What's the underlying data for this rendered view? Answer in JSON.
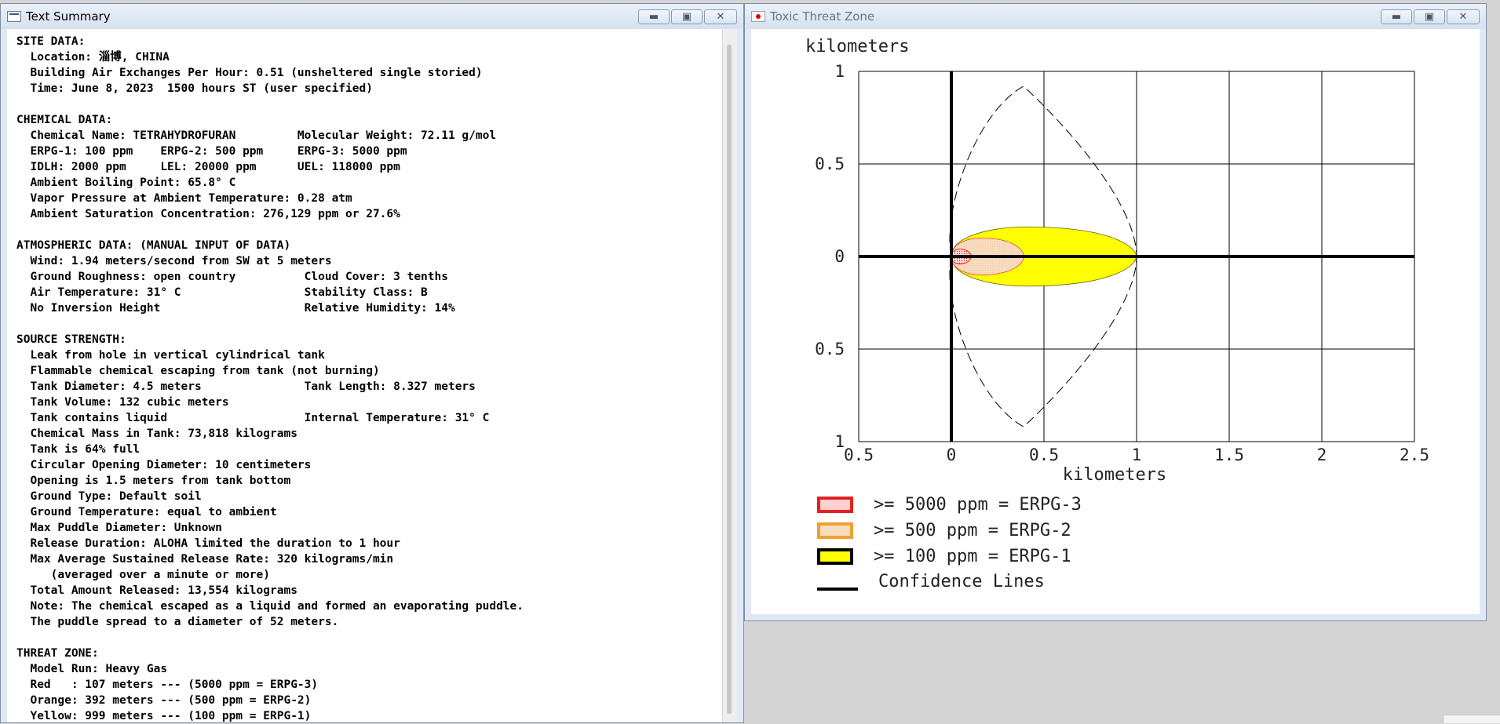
{
  "text_summary": {
    "title": "Text Summary",
    "content": "SITE DATA:\n  Location: 淄博, CHINA\n  Building Air Exchanges Per Hour: 0.51 (unsheltered single storied)\n  Time: June 8, 2023  1500 hours ST (user specified)\n\nCHEMICAL DATA:\n  Chemical Name: TETRAHYDROFURAN         Molecular Weight: 72.11 g/mol\n  ERPG-1: 100 ppm    ERPG-2: 500 ppm     ERPG-3: 5000 ppm\n  IDLH: 2000 ppm     LEL: 20000 ppm      UEL: 118000 ppm\n  Ambient Boiling Point: 65.8° C\n  Vapor Pressure at Ambient Temperature: 0.28 atm\n  Ambient Saturation Concentration: 276,129 ppm or 27.6%\n\nATMOSPHERIC DATA: (MANUAL INPUT OF DATA)\n  Wind: 1.94 meters/second from SW at 5 meters\n  Ground Roughness: open country          Cloud Cover: 3 tenths\n  Air Temperature: 31° C                  Stability Class: B\n  No Inversion Height                     Relative Humidity: 14%\n\nSOURCE STRENGTH:\n  Leak from hole in vertical cylindrical tank\n  Flammable chemical escaping from tank (not burning)\n  Tank Diameter: 4.5 meters               Tank Length: 8.327 meters\n  Tank Volume: 132 cubic meters\n  Tank contains liquid                    Internal Temperature: 31° C\n  Chemical Mass in Tank: 73,818 kilograms\n  Tank is 64% full\n  Circular Opening Diameter: 10 centimeters\n  Opening is 1.5 meters from tank bottom\n  Ground Type: Default soil\n  Ground Temperature: equal to ambient\n  Max Puddle Diameter: Unknown\n  Release Duration: ALOHA limited the duration to 1 hour\n  Max Average Sustained Release Rate: 320 kilograms/min\n     (averaged over a minute or more)\n  Total Amount Released: 13,554 kilograms\n  Note: The chemical escaped as a liquid and formed an evaporating puddle.\n  The puddle spread to a diameter of 52 meters.\n\nTHREAT ZONE:\n  Model Run: Heavy Gas\n  Red   : 107 meters --- (5000 ppm = ERPG-3)\n  Orange: 392 meters --- (500 ppm = ERPG-2)\n  Yellow: 999 meters --- (100 ppm = ERPG-1)"
  },
  "threat_zone": {
    "title": "Toxic Threat Zone",
    "y_axis_label": "kilometers",
    "x_axis_label": "kilometers",
    "x_ticks": [
      "0.5",
      "0",
      "0.5",
      "1",
      "1.5",
      "2",
      "2.5"
    ],
    "y_ticks": [
      "1",
      "0.5",
      "0",
      "0.5",
      "1"
    ],
    "legend": [
      {
        "label": ">= 5000 ppm = ERPG-3"
      },
      {
        "label": ">= 500 ppm = ERPG-2"
      },
      {
        "label": ">= 100 ppm = ERPG-1"
      },
      {
        "label": "Confidence Lines"
      }
    ],
    "colors": {
      "erpg3": "#e02020",
      "erpg2": "#f0a030",
      "erpg1": "#ffff00",
      "grid": "#000000"
    }
  },
  "chart_data": {
    "type": "area",
    "x_range": [
      -0.5,
      2.5
    ],
    "y_range": [
      -1,
      1
    ],
    "grid": true,
    "legend_position": "bottom-left",
    "zones": [
      {
        "name": "ERPG-3",
        "reach_km": 0.107,
        "half_width_km": 0.04
      },
      {
        "name": "ERPG-2",
        "reach_km": 0.392,
        "half_width_km": 0.1
      },
      {
        "name": "ERPG-1",
        "reach_km": 0.999,
        "half_width_km": 0.16
      }
    ],
    "confidence_lines": {
      "apex_x_km": 0.39,
      "half_width_km": 0.92,
      "end_x_km": 1.0
    }
  }
}
